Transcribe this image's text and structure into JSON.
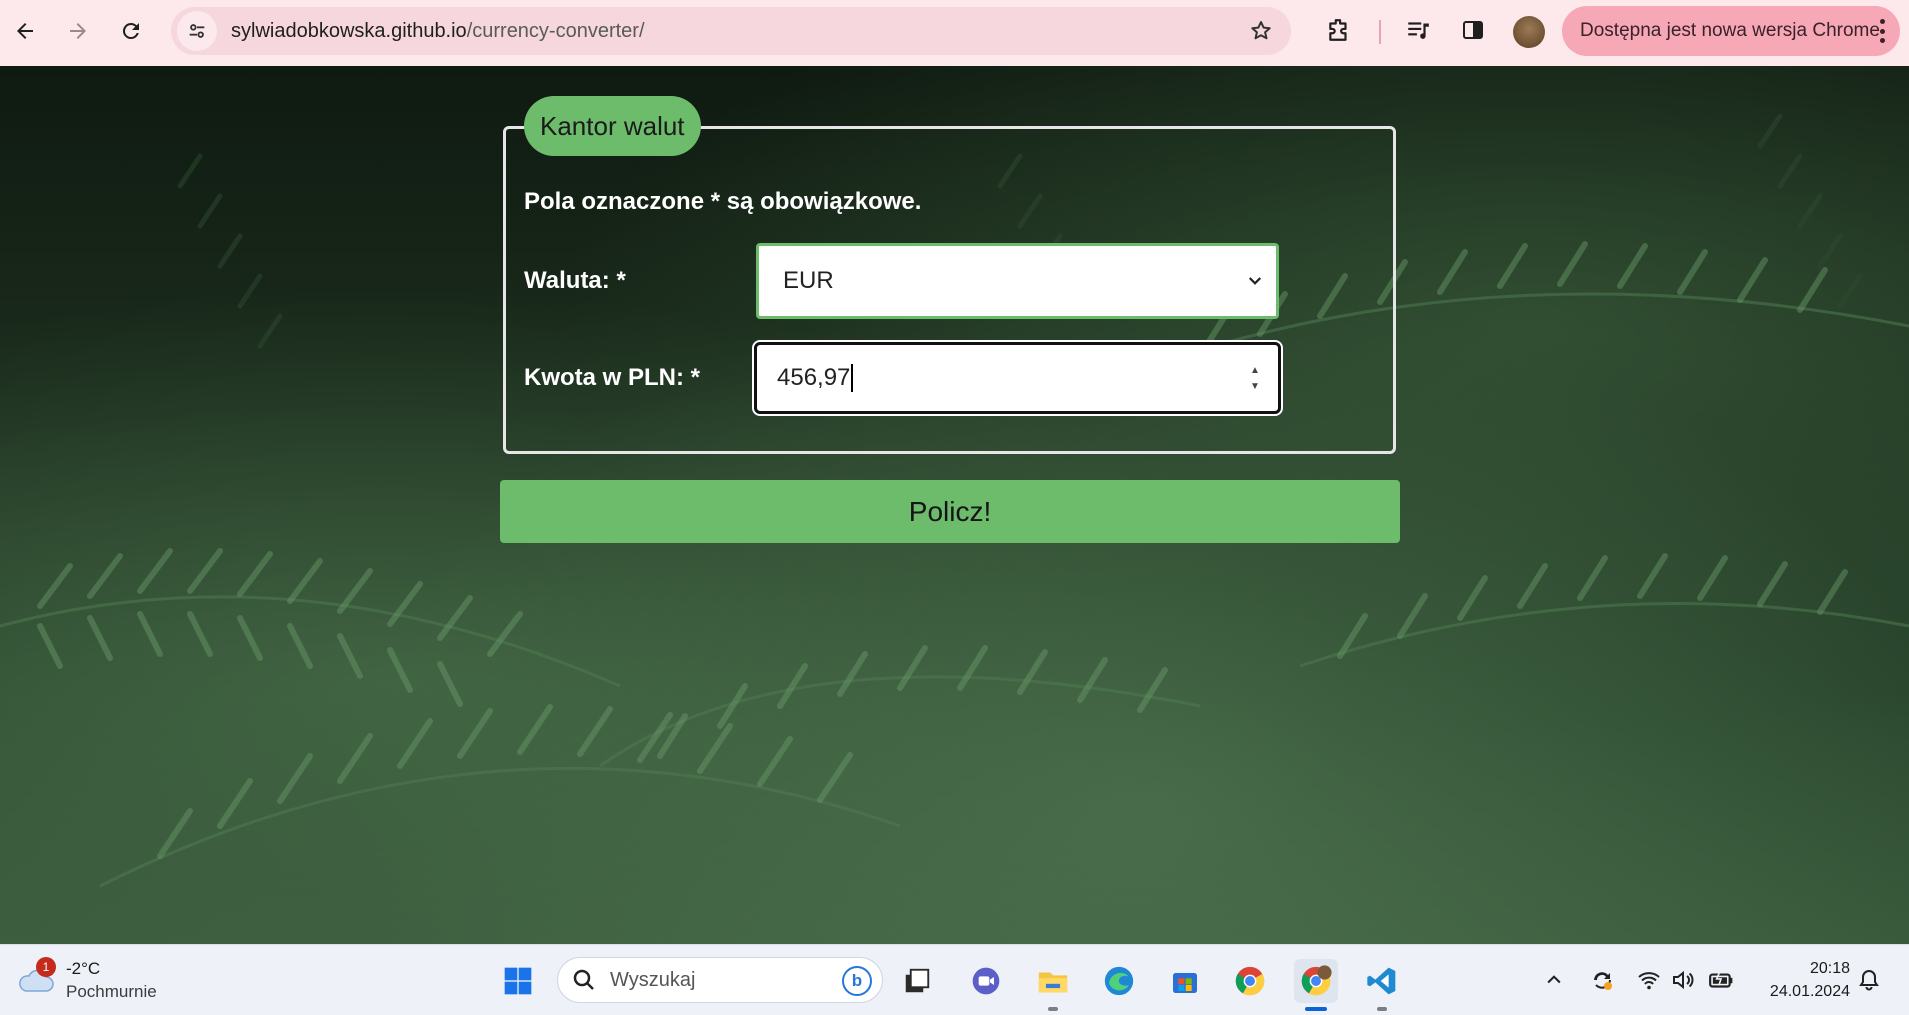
{
  "browser": {
    "url_host": "sylwiadobkowska.github.io",
    "url_path": "/currency-converter/",
    "update_banner": "Dostępna jest nowa wersja Chrome"
  },
  "form": {
    "legend": "Kantor walut",
    "required_note": "Pola oznaczone * są obowiązkowe.",
    "currency_label": "Waluta: *",
    "currency_value": "EUR",
    "amount_label": "Kwota w PLN: *",
    "amount_value": "456,97",
    "submit_label": "Policz!"
  },
  "colors": {
    "accent_green": "#6cbc6c",
    "chrome_bar": "#fde8ec",
    "update_pill": "#f6a8b6"
  },
  "taskbar": {
    "weather_badge": "1",
    "weather_temp": "-2°C",
    "weather_desc": "Pochmurnie",
    "search_placeholder": "Wyszukaj",
    "time": "20:18",
    "date": "24.01.2024"
  }
}
